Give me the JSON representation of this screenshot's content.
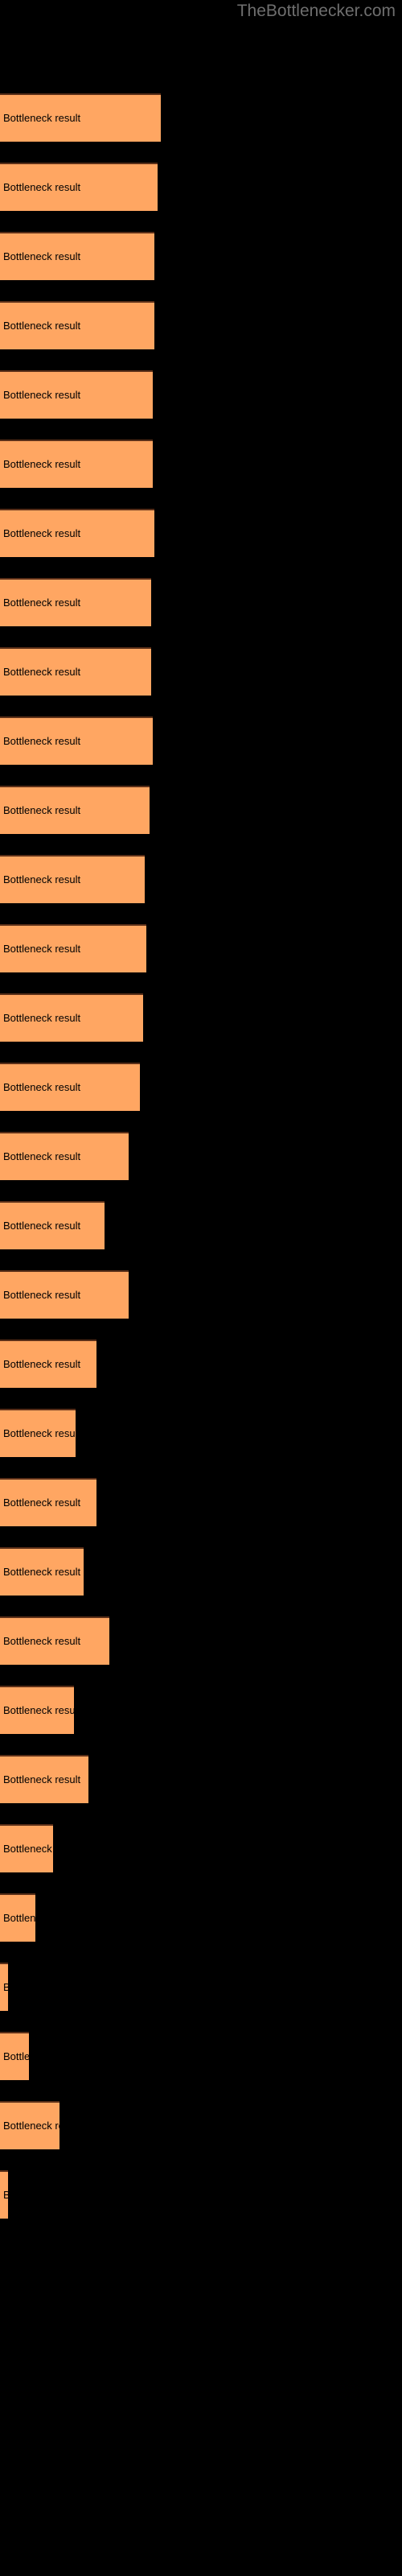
{
  "watermark": "TheBottlenecker.com",
  "colors": {
    "background": "#000000",
    "bar_fill": "#ffa662",
    "bar_edge": "#5a2f18",
    "label_text": "#000000",
    "watermark_text": "#6e6e6e"
  },
  "chart_data": {
    "type": "bar",
    "orientation": "horizontal",
    "title": "",
    "subtitle": "",
    "xlabel": "",
    "ylabel": "",
    "grid": false,
    "legend": null,
    "bar_label_text": "Bottleneck result",
    "xlim": [
      0,
      500
    ],
    "categories": [
      "Bottleneck result",
      "Bottleneck result",
      "Bottleneck result",
      "Bottleneck result",
      "Bottleneck result",
      "Bottleneck result",
      "Bottleneck result",
      "Bottleneck result",
      "Bottleneck result",
      "Bottleneck result",
      "Bottleneck result",
      "Bottleneck result",
      "Bottleneck result",
      "Bottleneck result",
      "Bottleneck result",
      "Bottleneck result",
      "Bottleneck result",
      "Bottleneck result",
      "Bottleneck result",
      "Bottleneck result",
      "Bottleneck result",
      "Bottleneck result",
      "Bottleneck result",
      "Bottleneck result",
      "Bottleneck result",
      "Bottleneck result",
      "Bottleneck result",
      "Bottleneck result",
      "Bottleneck result",
      "Bottleneck result",
      "Bottleneck result"
    ],
    "values": [
      100,
      98,
      96,
      96,
      95,
      95,
      96,
      94,
      94,
      95,
      93,
      90,
      91,
      89,
      87,
      80,
      65,
      80,
      60,
      47,
      60,
      52,
      68,
      46,
      55,
      33,
      22,
      5,
      18,
      37,
      5
    ],
    "bars": [
      {
        "y": 58,
        "width": 100,
        "label": "Bottleneck result"
      },
      {
        "y": 101,
        "width": 98,
        "label": "Bottleneck result"
      },
      {
        "y": 144,
        "width": 96,
        "label": "Bottleneck result"
      },
      {
        "y": 187,
        "width": 96,
        "label": "Bottleneck result"
      },
      {
        "y": 230,
        "width": 95,
        "label": "Bottleneck result"
      },
      {
        "y": 273,
        "width": 95,
        "label": "Bottleneck result"
      },
      {
        "y": 316,
        "width": 96,
        "label": "Bottleneck result"
      },
      {
        "y": 359,
        "width": 94,
        "label": "Bottleneck result"
      },
      {
        "y": 402,
        "width": 94,
        "label": "Bottleneck result"
      },
      {
        "y": 445,
        "width": 95,
        "label": "Bottleneck result"
      },
      {
        "y": 488,
        "width": 93,
        "label": "Bottleneck result"
      },
      {
        "y": 531,
        "width": 90,
        "label": "Bottleneck result"
      },
      {
        "y": 574,
        "width": 91,
        "label": "Bottleneck result"
      },
      {
        "y": 617,
        "width": 89,
        "label": "Bottleneck result"
      },
      {
        "y": 660,
        "width": 87,
        "label": "Bottleneck result"
      },
      {
        "y": 703,
        "width": 80,
        "label": "Bottleneck result"
      },
      {
        "y": 746,
        "width": 65,
        "label": "Bottleneck result"
      },
      {
        "y": 789,
        "width": 80,
        "label": "Bottleneck result"
      },
      {
        "y": 832,
        "width": 60,
        "label": "Bottleneck result"
      },
      {
        "y": 875,
        "width": 47,
        "label": "Bottleneck result"
      },
      {
        "y": 918,
        "width": 60,
        "label": "Bottleneck result"
      },
      {
        "y": 961,
        "width": 52,
        "label": "Bottleneck result"
      },
      {
        "y": 1004,
        "width": 68,
        "label": "Bottleneck result"
      },
      {
        "y": 1047,
        "width": 46,
        "label": "Bottleneck result"
      },
      {
        "y": 1090,
        "width": 55,
        "label": "Bottleneck result"
      },
      {
        "y": 1133,
        "width": 33,
        "label": "Bottleneck result"
      },
      {
        "y": 1176,
        "width": 22,
        "label": "Bottleneck result"
      },
      {
        "y": 1219,
        "width": 5,
        "label": "Bottleneck result"
      },
      {
        "y": 1262,
        "width": 18,
        "label": "Bottleneck result"
      },
      {
        "y": 1305,
        "width": 37,
        "label": "Bottleneck result"
      },
      {
        "y": 1348,
        "width": 5,
        "label": "Bottleneck result"
      }
    ]
  }
}
